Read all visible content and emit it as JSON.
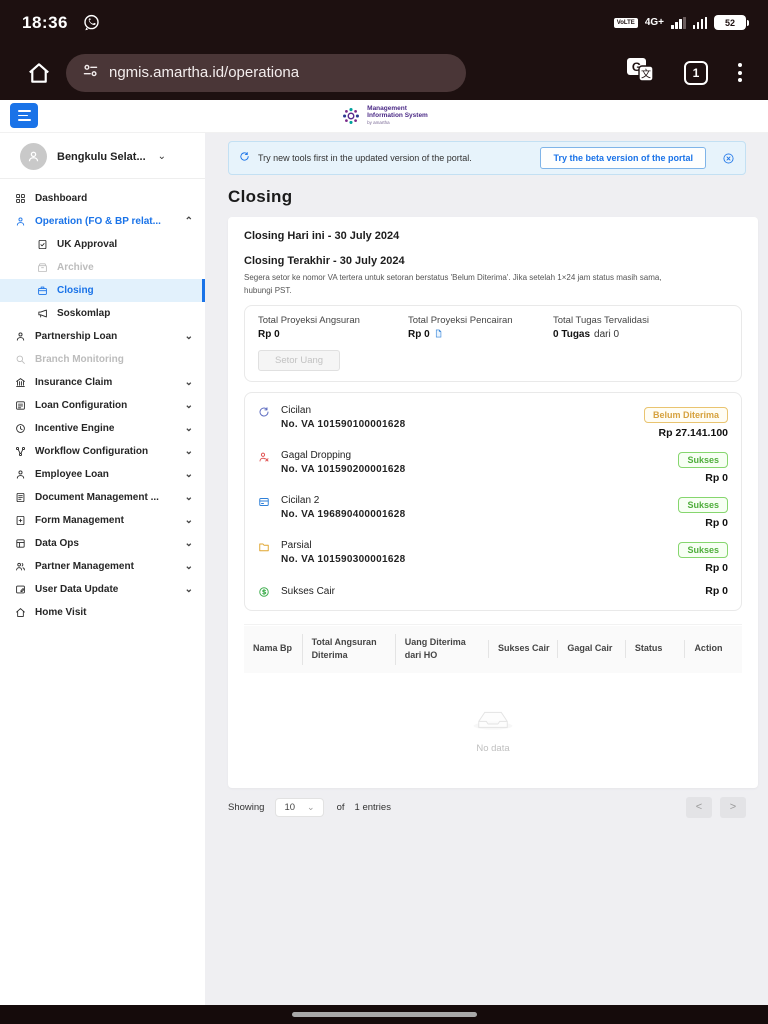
{
  "status_bar": {
    "time": "18:36",
    "battery_percent": "52",
    "volte_label": "VoLTE",
    "network_type": "4G+"
  },
  "browser": {
    "url": "ngmis.amartha.id/operationa",
    "tab_count": "1"
  },
  "header": {
    "logo_line1": "Management",
    "logo_line2": "Information System",
    "logo_sub": "by amartha"
  },
  "sidebar": {
    "user": {
      "name": "Bengkulu Selat...",
      "chevron": "⌄"
    },
    "items": [
      {
        "label": "Dashboard",
        "icon": "grid-icon"
      },
      {
        "label": "Operation (FO & BP relat...",
        "icon": "user-icon",
        "chevron": "up",
        "section_open": true
      },
      {
        "label": "UK Approval",
        "icon": "doc-check-icon",
        "sub": true
      },
      {
        "label": "Archive",
        "icon": "archive-icon",
        "sub": true,
        "disabled": true
      },
      {
        "label": "Closing",
        "icon": "briefcase-icon",
        "sub": true,
        "active": true
      },
      {
        "label": "Soskomlap",
        "icon": "megaphone-icon",
        "sub": true
      },
      {
        "label": "Partnership Loan",
        "icon": "user-icon",
        "chevron": "down"
      },
      {
        "label": "Branch Monitoring",
        "icon": "search-icon",
        "disabled": true
      },
      {
        "label": "Insurance Claim",
        "icon": "bank-icon",
        "chevron": "down"
      },
      {
        "label": "Loan Configuration",
        "icon": "list-icon",
        "chevron": "down"
      },
      {
        "label": "Incentive Engine",
        "icon": "clock-icon",
        "chevron": "down"
      },
      {
        "label": "Workflow Configuration",
        "icon": "workflow-icon",
        "chevron": "down"
      },
      {
        "label": "Employee Loan",
        "icon": "user-icon",
        "chevron": "down"
      },
      {
        "label": "Document Management ...",
        "icon": "document-icon",
        "chevron": "down"
      },
      {
        "label": "Form Management",
        "icon": "form-icon",
        "chevron": "down"
      },
      {
        "label": "Data Ops",
        "icon": "data-icon",
        "chevron": "down"
      },
      {
        "label": "Partner Management",
        "icon": "users-icon",
        "chevron": "down"
      },
      {
        "label": "User Data Update",
        "icon": "user-edit-icon",
        "chevron": "down"
      },
      {
        "label": "Home Visit",
        "icon": "home-icon"
      }
    ]
  },
  "banner": {
    "text": "Try new tools first in the updated version of the portal.",
    "button_label": "Try the beta version of the portal"
  },
  "page": {
    "title": "Closing"
  },
  "closing": {
    "today_heading": "Closing Hari ini - 30 July 2024",
    "last_heading": "Closing Terakhir - 30 July 2024",
    "note": "Segera setor ke nomor VA tertera untuk setoran berstatus 'Belum Diterima'. Jika setelah 1×24 jam status masih sama, hubungi PST.",
    "summary": {
      "col1_label": "Total Proyeksi Angsuran",
      "col1_value": "Rp 0",
      "col2_label": "Total Proyeksi Pencairan",
      "col2_value": "Rp 0",
      "col3_label": "Total Tugas Tervalidasi",
      "col3_value_bold": "0 Tugas",
      "col3_value_rest": "dari 0",
      "setor_button": "Setor Uang"
    },
    "va_items": [
      {
        "title": "Cicilan",
        "va": "No. VA 101590100001628",
        "badge": "Belum Diterima",
        "badge_type": "warning",
        "amount": "Rp 27.141.100",
        "icon": "sync-icon",
        "icon_color": "#5c6bc0"
      },
      {
        "title": "Gagal Dropping",
        "va": "No. VA 101590200001628",
        "badge": "Sukses",
        "badge_type": "success",
        "amount": "Rp 0",
        "icon": "user-x-icon",
        "icon_color": "#e05252"
      },
      {
        "title": "Cicilan 2",
        "va": "No. VA 196890400001628",
        "badge": "Sukses",
        "badge_type": "success",
        "amount": "Rp 0",
        "icon": "card-icon",
        "icon_color": "#2f80d8"
      },
      {
        "title": "Parsial",
        "va": "No. VA 101590300001628",
        "badge": "Sukses",
        "badge_type": "success",
        "amount": "Rp 0",
        "icon": "folder-icon",
        "icon_color": "#e0a52f"
      },
      {
        "title": "Sukses Cair",
        "va": "",
        "badge": "",
        "badge_type": "",
        "amount": "Rp 0",
        "icon": "coin-icon",
        "icon_color": "#3fae4e"
      }
    ],
    "table": {
      "columns": [
        "Nama Bp",
        "Total Angsuran Diterima",
        "Uang Diterima dari HO",
        "Sukses Cair",
        "Gagal Cair",
        "Status",
        "Action"
      ],
      "empty_text": "No data"
    },
    "pagination": {
      "showing_label": "Showing",
      "page_size": "10",
      "of_label": "of",
      "entries_label": "1 entries"
    }
  }
}
